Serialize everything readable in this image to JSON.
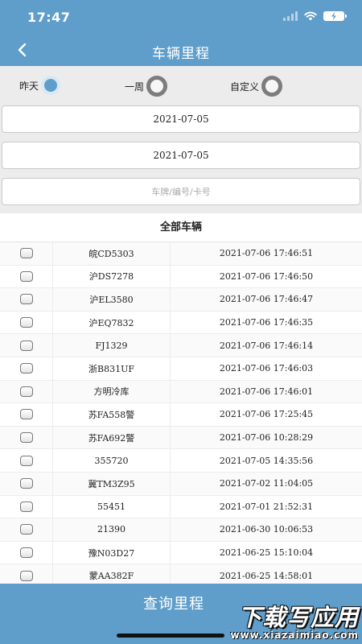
{
  "status": {
    "time": "17:47"
  },
  "nav": {
    "title": "车辆里程"
  },
  "periods": [
    {
      "label": "昨天",
      "selected": true
    },
    {
      "label": "一周",
      "selected": false
    },
    {
      "label": "自定义",
      "selected": false
    }
  ],
  "fields": {
    "start_date": "2021-07-05",
    "end_date": "2021-07-05",
    "search_placeholder": "车牌/编号/卡号"
  },
  "list": {
    "title": "全部车辆",
    "rows": [
      {
        "plate": "皖CD5303",
        "time": "2021-07-06 17:46:51"
      },
      {
        "plate": "沪DS7278",
        "time": "2021-07-06 17:46:50"
      },
      {
        "plate": "沪EL3580",
        "time": "2021-07-06 17:46:47"
      },
      {
        "plate": "沪EQ7832",
        "time": "2021-07-06 17:46:35"
      },
      {
        "plate": "FJ1329",
        "time": "2021-07-06 17:46:14"
      },
      {
        "plate": "浙B831UF",
        "time": "2021-07-06 17:46:03"
      },
      {
        "plate": "方明冷库",
        "time": "2021-07-06 17:46:01"
      },
      {
        "plate": "苏FA558警",
        "time": "2021-07-06 17:25:45"
      },
      {
        "plate": "苏FA692警",
        "time": "2021-07-06 10:28:29"
      },
      {
        "plate": "355720",
        "time": "2021-07-05 14:35:56"
      },
      {
        "plate": "冀TM3Z95",
        "time": "2021-07-02 11:04:05"
      },
      {
        "plate": "55451",
        "time": "2021-07-01 21:52:31"
      },
      {
        "plate": "21390",
        "time": "2021-06-30 10:06:53"
      },
      {
        "plate": "豫N03D27",
        "time": "2021-06-25 15:10:04"
      },
      {
        "plate": "蒙AA382F",
        "time": "2021-06-25 14:58:01"
      }
    ]
  },
  "bottom": {
    "button_label": "查询里程"
  },
  "watermark": {
    "top": "下载写应用",
    "bottom": "www.xiazaimiao.com"
  },
  "colors": {
    "primary": "#5f9ecb",
    "background": "#ececec"
  },
  "icons": {
    "back": "back-chevron-icon",
    "wifi": "wifi-icon",
    "battery": "battery-charging-icon",
    "signal": "cellular-signal-icon"
  }
}
